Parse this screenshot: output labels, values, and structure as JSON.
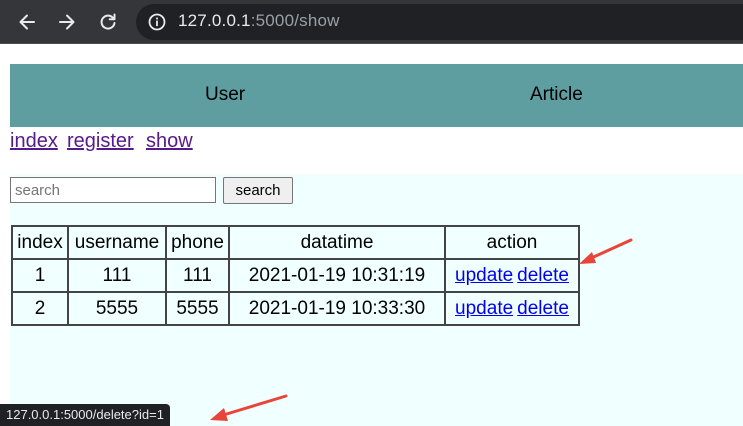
{
  "browser": {
    "url_host": "127.0.0.1",
    "url_rest": ":5000/show",
    "icons": {
      "back": "back-arrow-icon",
      "forward": "forward-arrow-icon",
      "reload": "reload-icon",
      "info": "info-icon"
    }
  },
  "header": {
    "user": "User",
    "article": "Article"
  },
  "links": {
    "index": "index",
    "register": "register",
    "show": "show"
  },
  "search": {
    "placeholder": "search",
    "value": "",
    "button": "search"
  },
  "table": {
    "headers": [
      "index",
      "username",
      "phone",
      "datatime",
      "action"
    ],
    "rows": [
      {
        "index": "1",
        "username": "111",
        "phone": "111",
        "datatime": "2021-01-19 10:31:19",
        "update": "update",
        "delete": "delete"
      },
      {
        "index": "2",
        "username": "5555",
        "phone": "5555",
        "datatime": "2021-01-19 10:33:30",
        "update": "update",
        "delete": "delete"
      }
    ]
  },
  "status_bar": {
    "text": "127.0.0.1:5000/delete?id=1"
  },
  "colors": {
    "header_bg": "#5f9ea0",
    "content_bg": "#f0ffff",
    "annotation_arrow": "#e8443a",
    "link": "#0000ee",
    "visited_link": "#551a8b"
  }
}
